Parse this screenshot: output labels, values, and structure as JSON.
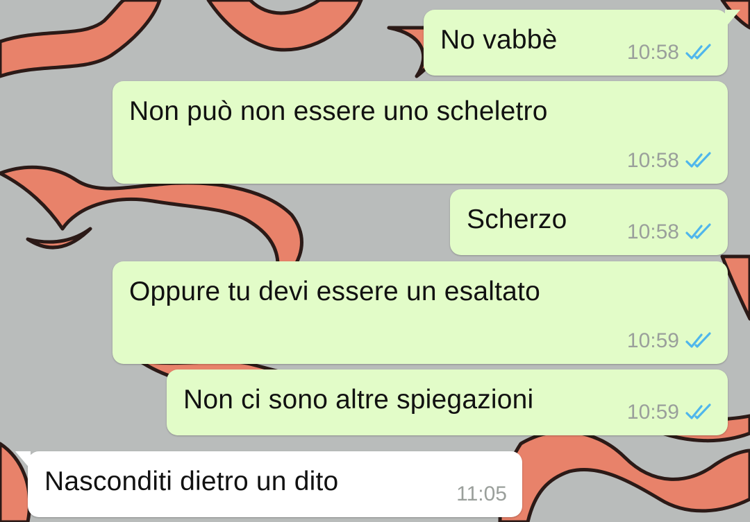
{
  "colors": {
    "outgoing_bubble": "#e2fcc8",
    "incoming_bubble": "#ffffff",
    "read_ticks": "#4fb6ec",
    "timestamp": "#9a9f9b",
    "wallpaper_base": "#b9bcbb",
    "wallpaper_flame": "#e8826a",
    "wallpaper_outline": "#2b1a17"
  },
  "messages": [
    {
      "direction": "outgoing",
      "text": "No vabbè",
      "time": "10:58",
      "status": "read",
      "status_icon": "double-check-icon"
    },
    {
      "direction": "outgoing",
      "text": "Non può non essere uno scheletro",
      "time": "10:58",
      "status": "read",
      "status_icon": "double-check-icon"
    },
    {
      "direction": "outgoing",
      "text": "Scherzo",
      "time": "10:58",
      "status": "read",
      "status_icon": "double-check-icon"
    },
    {
      "direction": "outgoing",
      "text": "Oppure tu devi essere un esaltato",
      "time": "10:59",
      "status": "read",
      "status_icon": "double-check-icon"
    },
    {
      "direction": "outgoing",
      "text": "Non ci sono altre spiegazioni",
      "time": "10:59",
      "status": "read",
      "status_icon": "double-check-icon"
    },
    {
      "direction": "incoming",
      "text": "Nasconditi dietro un dito",
      "time": "11:05"
    }
  ]
}
